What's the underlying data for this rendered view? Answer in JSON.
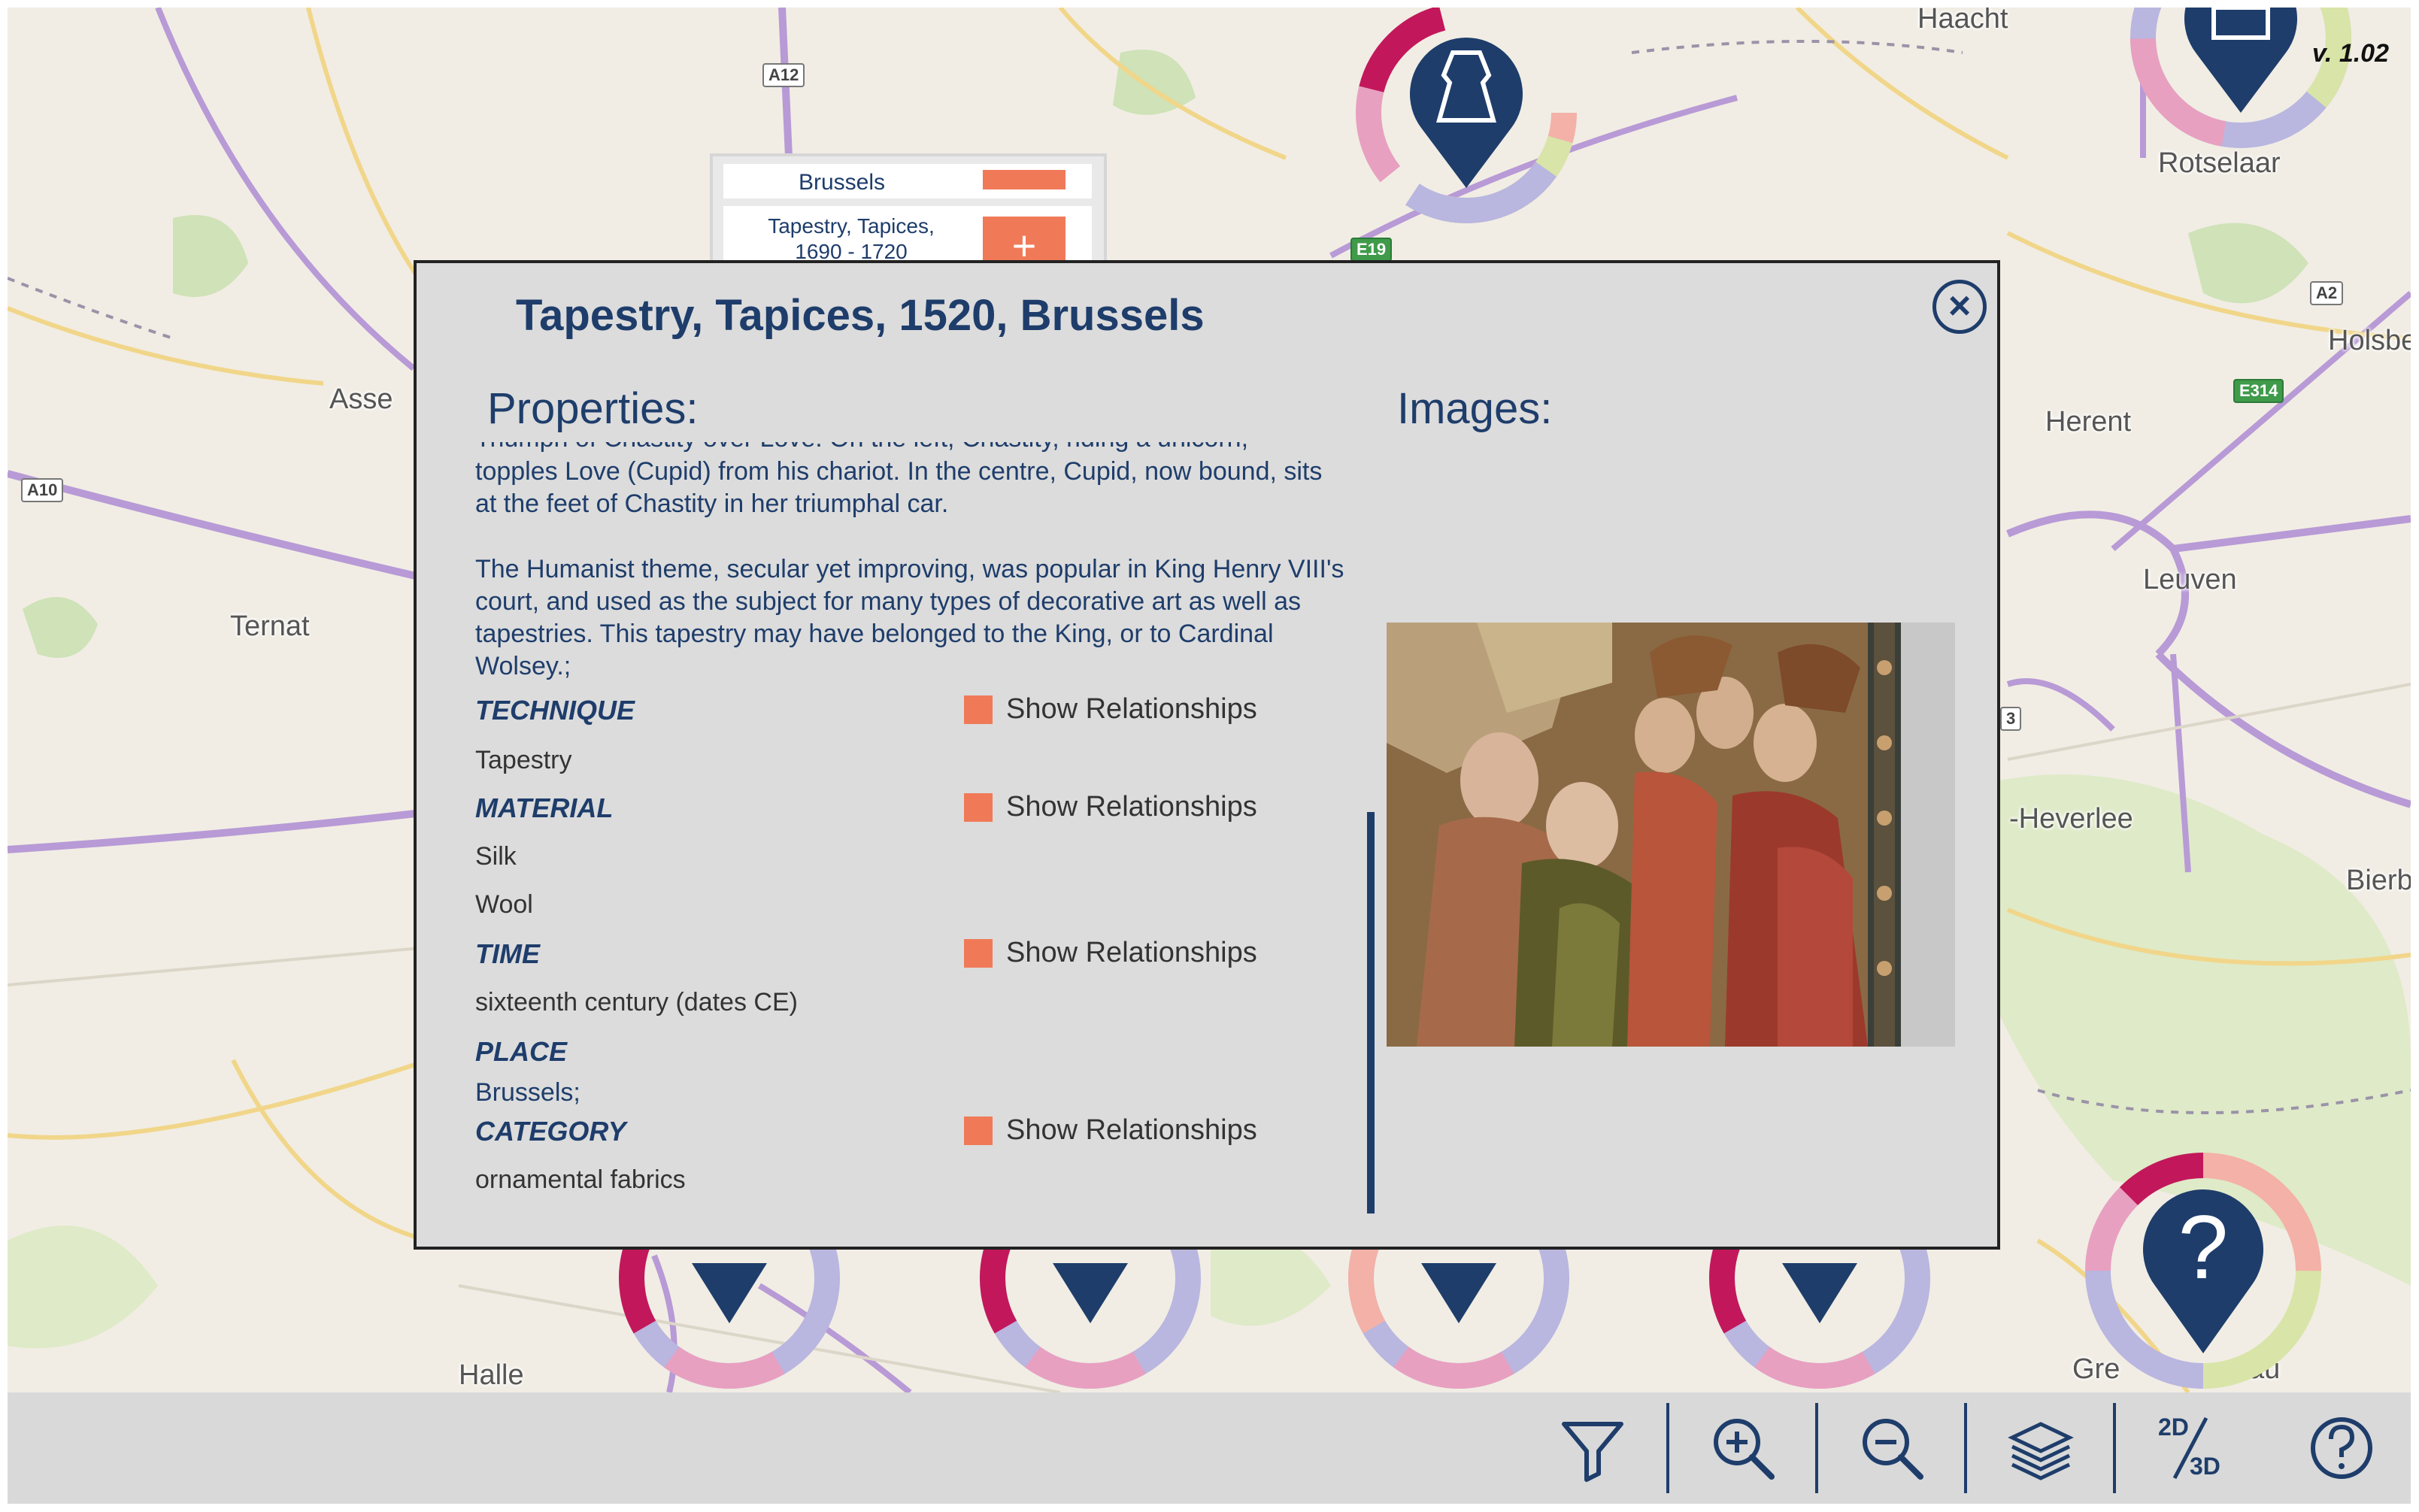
{
  "version": "v. 1.02",
  "map": {
    "places": {
      "haacht": "Haacht",
      "rotselaar": "Rotselaar",
      "holsbeek": "Holsbe",
      "herent": "Herent",
      "leuven": "Leuven",
      "heverlee": "-Heverlee",
      "bierbeek": "Bierb",
      "asse": "Asse",
      "ternat": "Ternat",
      "halle": "Halle",
      "grez": "Gre",
      "doiceau": "au"
    },
    "roads": {
      "a12": "A12",
      "a10": "A10",
      "a2": "A2",
      "e19": "E19",
      "e314": "E314",
      "a3": "3"
    }
  },
  "mini_popup": {
    "city": "Brussels",
    "item": "Tapestry, Tapices, 1690 - 1720",
    "plus": "+"
  },
  "modal": {
    "title": "Tapestry, Tapices, 1520, Brussels",
    "close_symbol": "×",
    "properties_heading": "Properties:",
    "images_heading": "Images:",
    "description_partial_top": "Triumph of Chastity over Love. On the left, Chastity, riding a unicorn,",
    "description_1": "topples Love (Cupid) from his chariot. In the centre, Cupid, now bound, sits at the feet of Chastity in her triumphal car.",
    "description_2": "The Humanist theme, secular yet improving, was popular in King Henry VIII's court, and used as the subject for many types of decorative art as well as tapestries. This tapestry may have belonged to the King, or to Cardinal Wolsey.;",
    "show_relationships_label": "Show Relationships",
    "technique": {
      "label": "TECHNIQUE",
      "values": [
        "Tapestry"
      ]
    },
    "material": {
      "label": "MATERIAL",
      "values": [
        "Silk",
        "Wool"
      ]
    },
    "time": {
      "label": "TIME",
      "values": [
        "sixteenth century (dates CE)"
      ]
    },
    "place": {
      "label": "PLACE",
      "values": [
        "Brussels;"
      ]
    },
    "category": {
      "label": "CATEGORY",
      "values": [
        "ornamental fabrics"
      ]
    }
  },
  "toolbar": {
    "dimension_toggle": {
      "top": "2D",
      "bottom": "3D"
    }
  },
  "colors": {
    "navy": "#1e3d6b",
    "accent_orange": "#f07a58",
    "ring_magenta": "#c2185b",
    "ring_pink": "#e8a0c0",
    "ring_lavender": "#b9b6e0",
    "ring_lime": "#d9e4a8",
    "ring_peach": "#f3b1a7"
  }
}
